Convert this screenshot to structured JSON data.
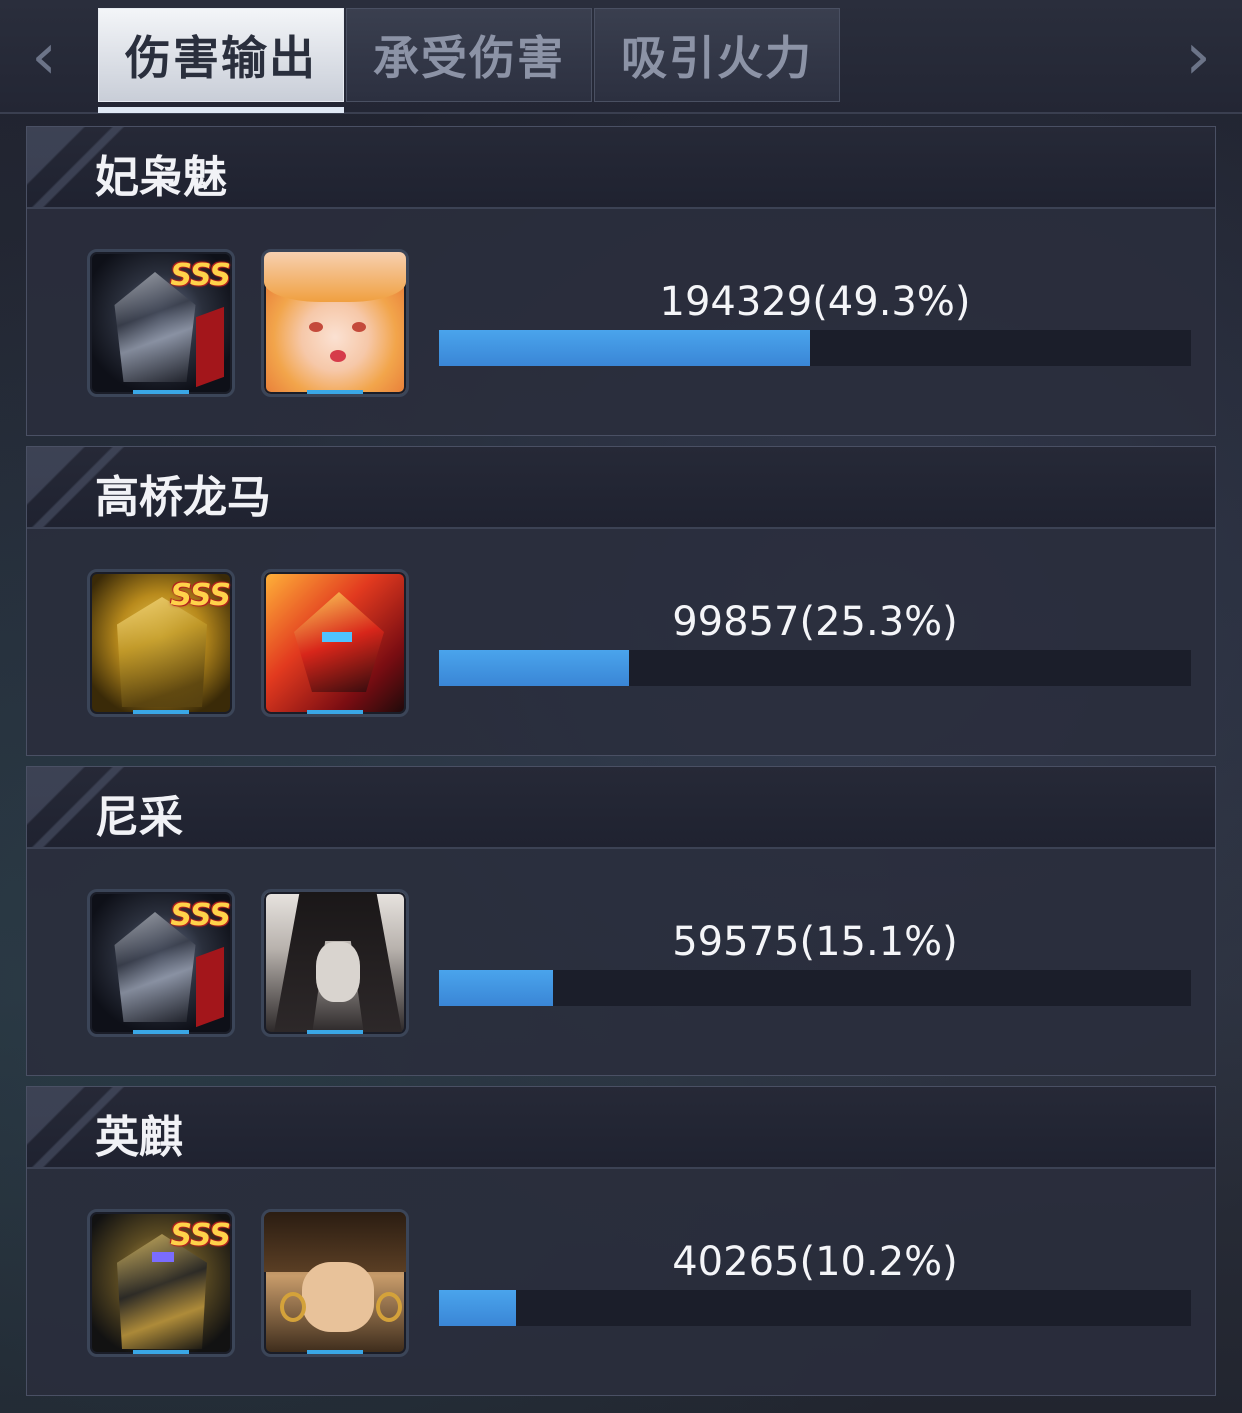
{
  "tabs": [
    {
      "label": "伤害输出",
      "active": true
    },
    {
      "label": "承受伤害",
      "active": false
    },
    {
      "label": "吸引火力",
      "active": false
    }
  ],
  "nav": {
    "prev_icon": "chevron-left-icon",
    "next_icon": "chevron-right-icon"
  },
  "colors": {
    "bar_fill": "#4aa4ec",
    "bar_track": "#1b1e2a",
    "active_tab": "#eef1f6"
  },
  "players": [
    {
      "name": "妃枭魅",
      "mech_rank": "SSS",
      "mech_theme": "dark-silver-red",
      "pilot_theme": "orange-hair",
      "value_text": "194329(49.3%)",
      "damage": 194329,
      "percent": 49.3
    },
    {
      "name": "高桥龙马",
      "mech_rank": "SSS",
      "mech_theme": "gold",
      "pilot_theme": "red-orange-mech",
      "value_text": "99857(25.3%)",
      "damage": 99857,
      "percent": 25.3
    },
    {
      "name": "尼采",
      "mech_rank": "SSS",
      "mech_theme": "dark-silver-red",
      "pilot_theme": "black-long-hair",
      "value_text": "59575(15.1%)",
      "damage": 59575,
      "percent": 15.1
    },
    {
      "name": "英麒",
      "mech_rank": "SSS",
      "mech_theme": "gold-black",
      "pilot_theme": "brown-hair-earrings",
      "value_text": "40265(10.2%)",
      "damage": 40265,
      "percent": 10.2
    }
  ]
}
